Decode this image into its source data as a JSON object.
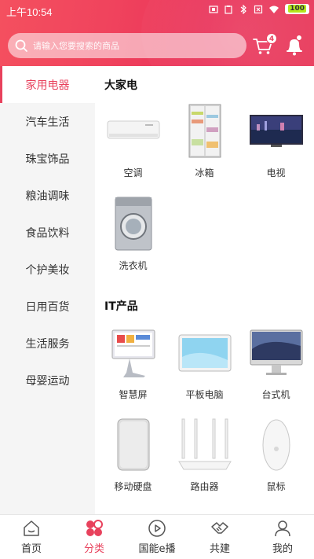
{
  "status_bar": {
    "time": "上午10:54",
    "battery": "100"
  },
  "search": {
    "placeholder": "请输入您要搜索的商品",
    "value": ""
  },
  "cart": {
    "badge_count": "4"
  },
  "sidebar": {
    "items": [
      {
        "label": "家用电器",
        "active": true
      },
      {
        "label": "汽车生活",
        "active": false
      },
      {
        "label": "珠宝饰品",
        "active": false
      },
      {
        "label": "粮油调味",
        "active": false
      },
      {
        "label": "食品饮料",
        "active": false
      },
      {
        "label": "个护美妆",
        "active": false
      },
      {
        "label": "日用百货",
        "active": false
      },
      {
        "label": "生活服务",
        "active": false
      },
      {
        "label": "母婴运动",
        "active": false
      }
    ]
  },
  "sections": [
    {
      "title": "大家电",
      "products": [
        {
          "name": "空调",
          "icon": "air-conditioner"
        },
        {
          "name": "冰箱",
          "icon": "refrigerator"
        },
        {
          "name": "电视",
          "icon": "television"
        },
        {
          "name": "洗衣机",
          "icon": "washing-machine"
        }
      ]
    },
    {
      "title": "IT产品",
      "products": [
        {
          "name": "智慧屏",
          "icon": "smart-screen"
        },
        {
          "name": "平板电脑",
          "icon": "tablet"
        },
        {
          "name": "台式机",
          "icon": "desktop-computer"
        },
        {
          "name": "移动硬盘",
          "icon": "portable-hard-drive"
        },
        {
          "name": "路由器",
          "icon": "router"
        },
        {
          "name": "鼠标",
          "icon": "mouse"
        }
      ]
    }
  ],
  "tabbar": {
    "tabs": [
      {
        "label": "首页",
        "icon": "home-icon",
        "active": false
      },
      {
        "label": "分类",
        "icon": "category-icon",
        "active": true
      },
      {
        "label": "国能e播",
        "icon": "play-icon",
        "active": false
      },
      {
        "label": "共建",
        "icon": "handshake-icon",
        "active": false
      },
      {
        "label": "我的",
        "icon": "profile-icon",
        "active": false
      }
    ]
  },
  "colors": {
    "accent": "#e8415c",
    "sidebar_bg": "#f5f5f5"
  }
}
